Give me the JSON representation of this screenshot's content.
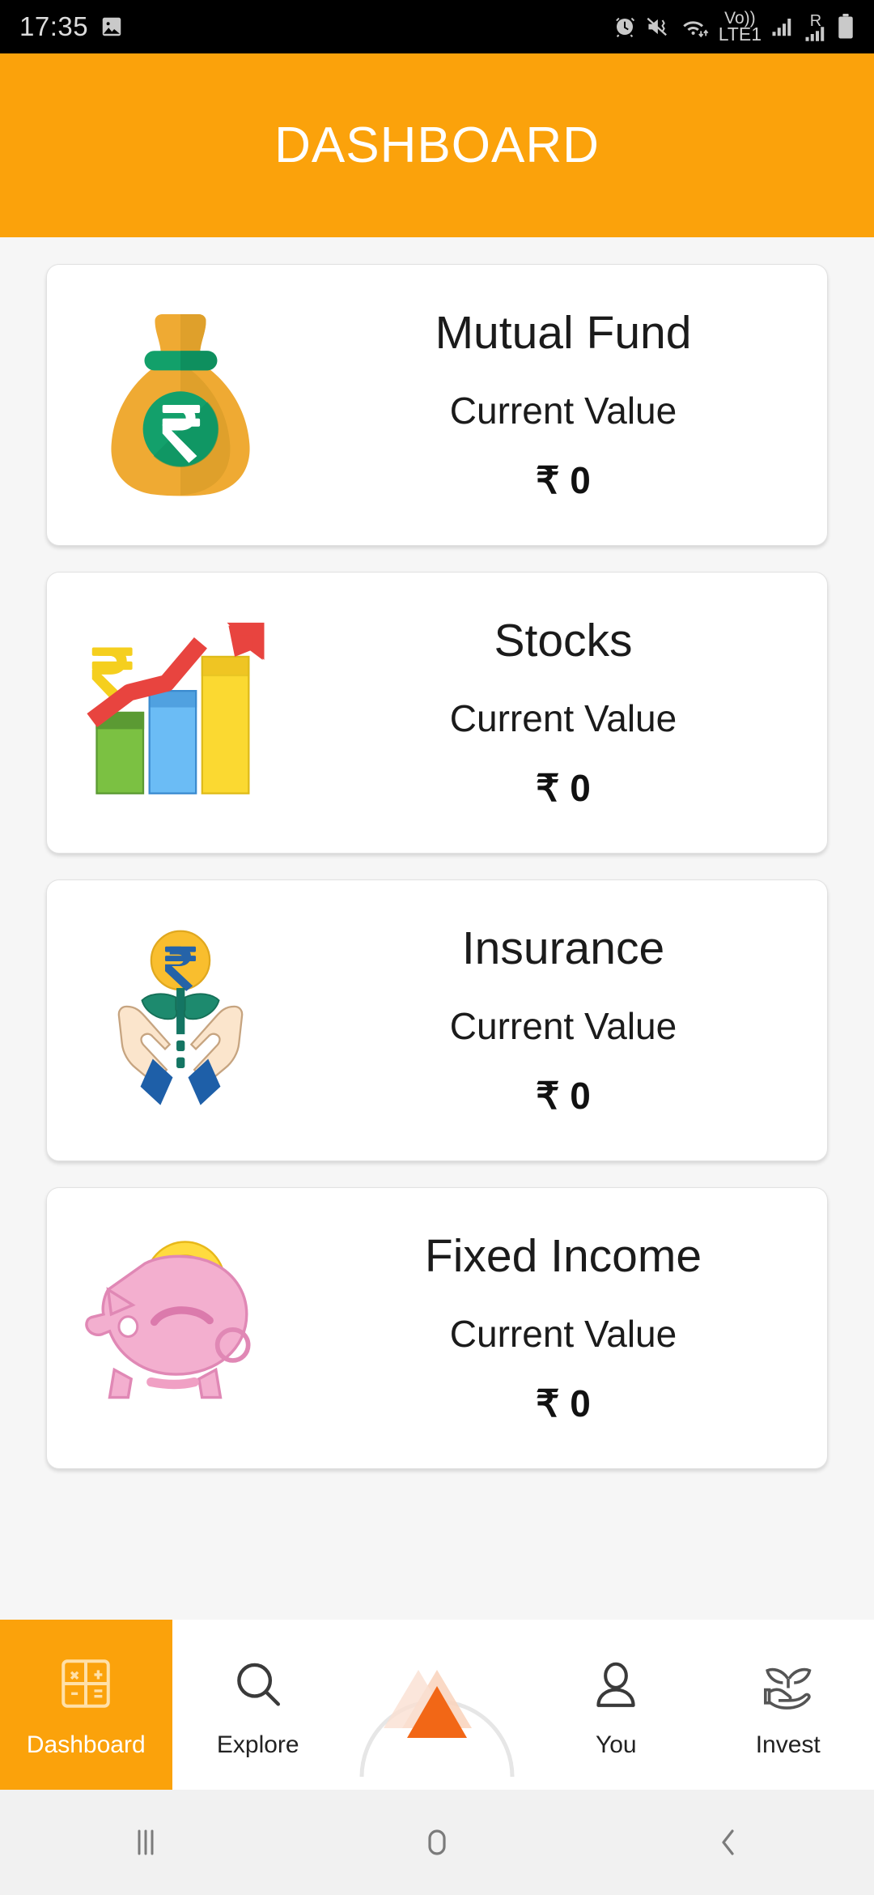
{
  "status_bar": {
    "time": "17:35",
    "left_icons": [
      "photo-icon"
    ],
    "right_icons": [
      "alarm-icon",
      "vibrate-mute-icon",
      "wifi-icon",
      "volte1-icon",
      "signal-bars-icon",
      "roaming-signal-icon",
      "battery-icon"
    ],
    "network_label_top": "Vo))",
    "network_label_bottom": "LTE1",
    "roaming_label": "R"
  },
  "app_bar": {
    "title": "DASHBOARD"
  },
  "theme": {
    "accent_orange": "#FBA20B",
    "page_background": "#F6F6F6",
    "card_background": "#FFFFFF",
    "text_primary": "#1B1B1B",
    "nav_bar_background": "#F1F1F1",
    "logo_orange": "#F26716"
  },
  "cards": [
    {
      "id": "mutual-fund",
      "title": "Mutual Fund",
      "label": "Current Value",
      "value": "₹ 0",
      "icon": "money-bag-icon"
    },
    {
      "id": "stocks",
      "title": "Stocks",
      "label": "Current Value",
      "value": "₹ 0",
      "icon": "growth-bar-chart-icon"
    },
    {
      "id": "insurance",
      "title": "Insurance",
      "label": "Current Value",
      "value": "₹ 0",
      "icon": "hands-plant-coin-icon"
    },
    {
      "id": "fixed-income",
      "title": "Fixed Income",
      "label": "Current Value",
      "value": "₹ 0",
      "icon": "piggy-bank-icon"
    }
  ],
  "bottom_nav": {
    "items": [
      {
        "id": "dashboard",
        "label": "Dashboard",
        "icon": "grid-dashboard-icon",
        "active": true
      },
      {
        "id": "explore",
        "label": "Explore",
        "icon": "search-icon",
        "active": false
      },
      {
        "id": "center-action",
        "label": "",
        "icon": "app-logo-triangle-icon",
        "active": false
      },
      {
        "id": "you",
        "label": "You",
        "icon": "person-icon",
        "active": false
      },
      {
        "id": "invest",
        "label": "Invest",
        "icon": "hand-sprout-icon",
        "active": false
      }
    ]
  },
  "android_nav": {
    "buttons": [
      {
        "id": "recents",
        "icon": "recents-bars-icon"
      },
      {
        "id": "home",
        "icon": "home-circle-icon"
      },
      {
        "id": "back",
        "icon": "back-chevron-icon"
      }
    ]
  }
}
